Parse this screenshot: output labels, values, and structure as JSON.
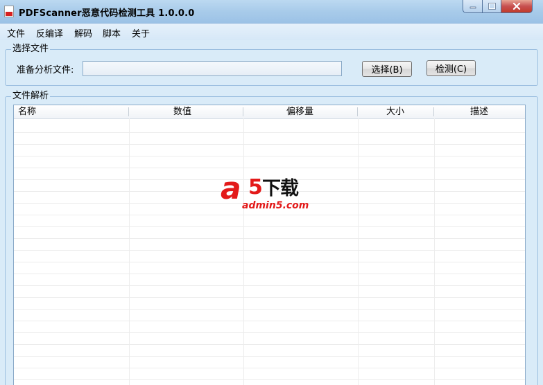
{
  "window": {
    "title": "PDFScanner恶意代码检测工具 1.0.0.0"
  },
  "menu": [
    "文件",
    "反编译",
    "解码",
    "脚本",
    "关于"
  ],
  "file_group": {
    "legend": "选择文件",
    "label": "准备分析文件:",
    "input_value": "",
    "select_button": "选择(B)",
    "detect_button": "检测(C)"
  },
  "parse_group": {
    "legend": "文件解析",
    "columns": [
      "名称",
      "数值",
      "偏移量",
      "大小",
      "描述"
    ]
  },
  "watermark": {
    "logo_a": "a",
    "logo_5": "5",
    "logo_cn": "下载",
    "url": "admin5.com"
  }
}
